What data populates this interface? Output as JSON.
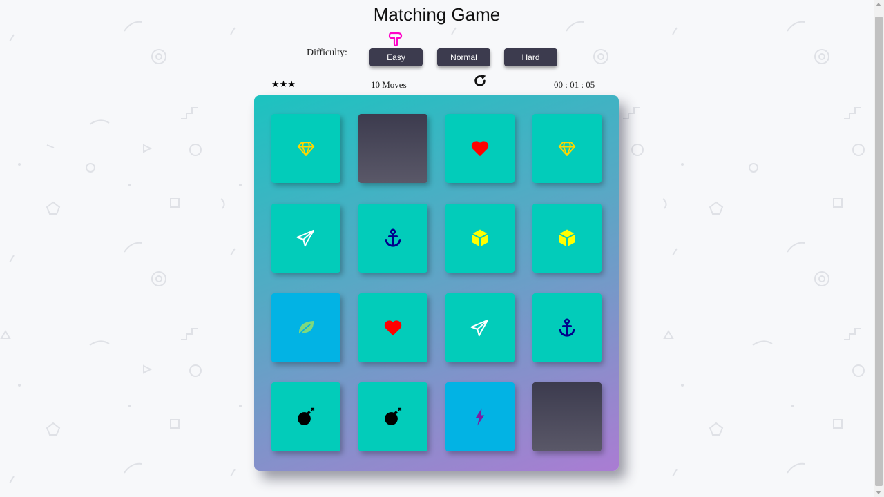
{
  "title": "Matching Game",
  "difficulty": {
    "label": "Difficulty:",
    "options": [
      "Easy",
      "Normal",
      "Hard"
    ]
  },
  "score_panel": {
    "stars": "★★★",
    "moves": "10 Moves",
    "timer": "00 : 01 : 05"
  },
  "colors": {
    "card_open": "#02ccba",
    "card_show": "#02b3e4",
    "card_closed": "#3c3b4e",
    "button": "#3c3b4e",
    "pointer": "#ff00c8"
  },
  "cards": [
    {
      "icon": "diamond-icon",
      "state": "open"
    },
    {
      "icon": "",
      "state": "closed"
    },
    {
      "icon": "heart-icon",
      "state": "open"
    },
    {
      "icon": "diamond-icon",
      "state": "open"
    },
    {
      "icon": "paper-plane-icon",
      "state": "open"
    },
    {
      "icon": "anchor-icon",
      "state": "open"
    },
    {
      "icon": "cube-icon",
      "state": "open"
    },
    {
      "icon": "cube-icon",
      "state": "open"
    },
    {
      "icon": "leaf-icon",
      "state": "show"
    },
    {
      "icon": "heart-icon",
      "state": "open"
    },
    {
      "icon": "paper-plane-icon",
      "state": "open"
    },
    {
      "icon": "anchor-icon",
      "state": "open"
    },
    {
      "icon": "bomb-icon",
      "state": "open"
    },
    {
      "icon": "bomb-icon",
      "state": "open"
    },
    {
      "icon": "bolt-icon",
      "state": "show"
    },
    {
      "icon": "",
      "state": "closed"
    }
  ]
}
